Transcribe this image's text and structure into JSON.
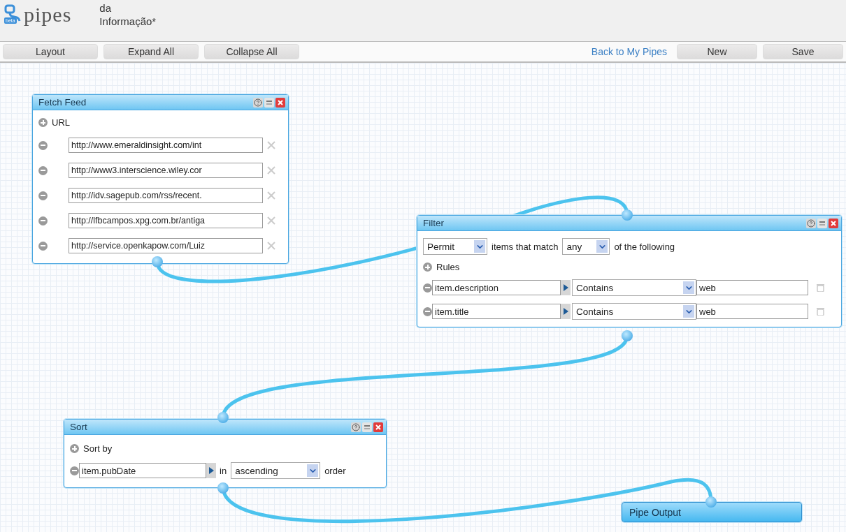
{
  "header": {
    "logo": "pipes",
    "logo_badge": "beta",
    "title_lines": [
      "da",
      "Informação*"
    ]
  },
  "toolbar": {
    "left_buttons": [
      "Layout",
      "Expand All",
      "Collapse All"
    ],
    "link": "Back to My Pipes",
    "right_buttons": [
      "New",
      "Save"
    ]
  },
  "modules": [
    {
      "kind": "fetch",
      "title": "Fetch Feed",
      "section": "URL",
      "urls": [
        "http://www.emeraldinsight.com/int",
        "http://www3.interscience.wiley.cor",
        "http://idv.sagepub.com/rss/recent.",
        "http://lfbcampos.xpg.com.br/antiga",
        "http://service.openkapow.com/Luiz"
      ]
    },
    {
      "kind": "filter",
      "title": "Filter",
      "mode": "Permit",
      "text_before": "items that match",
      "match": "any",
      "text_after": "of the following",
      "section": "Rules",
      "rules": [
        {
          "field": "item.description",
          "operator": "Contains",
          "value": "web"
        },
        {
          "field": "item.title",
          "operator": "Contains",
          "value": "web"
        }
      ]
    },
    {
      "kind": "sort",
      "title": "Sort",
      "section": "Sort by",
      "field": "item.pubDate",
      "text_in": "in",
      "order": "ascending",
      "text_after": "order"
    },
    {
      "kind": "output",
      "title": "Pipe Output"
    }
  ]
}
